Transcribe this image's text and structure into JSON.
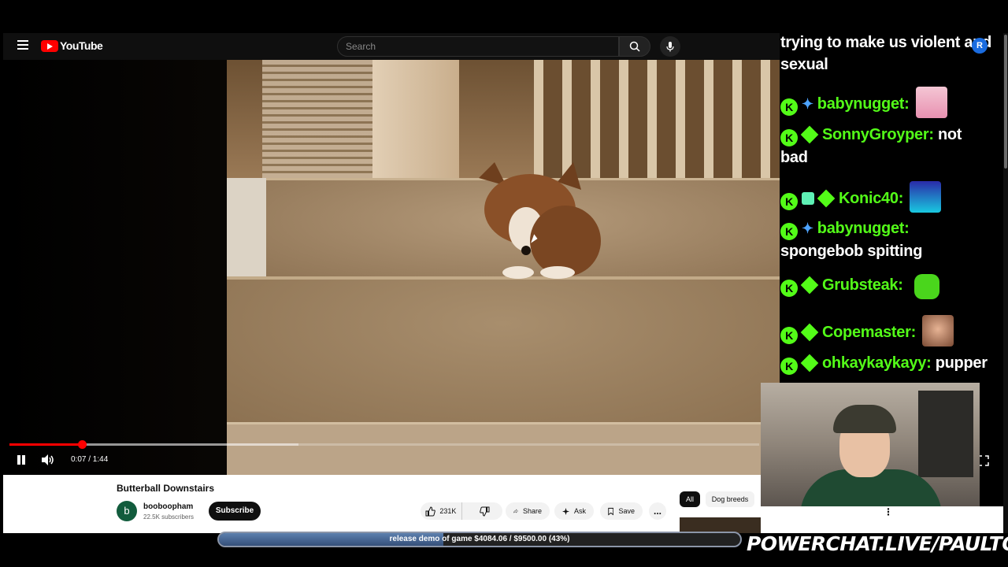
{
  "header": {
    "logo_text": "YouTube",
    "search_placeholder": "Search"
  },
  "player": {
    "current_time": "0:07",
    "duration": "1:44",
    "time_display": "0:07 / 1:44",
    "played_fraction": 0.097,
    "buffered_fraction": 0.385
  },
  "video": {
    "title": "Butterball Downstairs",
    "channel": {
      "avatar_letter": "b",
      "name": "booboopham",
      "subscribers": "22.5K subscribers",
      "subscribe_label": "Subscribe"
    },
    "actions": {
      "likes": "231K",
      "share_label": "Share",
      "ask_label": "Ask",
      "save_label": "Save",
      "more_label": "..."
    },
    "chips": {
      "all": "All",
      "dog_breeds": "Dog breeds"
    }
  },
  "chat": {
    "messages": [
      {
        "user": "",
        "text": "trying to make us violent and sexual"
      },
      {
        "user": "babynugget:",
        "text": ""
      },
      {
        "user": "SonnyGroyper:",
        "text": "not bad"
      },
      {
        "user": "Konic40:",
        "text": ""
      },
      {
        "user": "babynugget:",
        "text": "spongebob spitting"
      },
      {
        "user": "Grubsteak:",
        "text": ""
      },
      {
        "user": "Copemaster:",
        "text": ""
      },
      {
        "user": "ohkaykaykayy:",
        "text": "pupper"
      }
    ],
    "badge_letter": "K",
    "user_color": "#53fc18"
  },
  "account": {
    "avatar_letter": "R"
  },
  "goal": {
    "text": "release demo of game $4084.06 / $9500.00 (43%)",
    "fraction": 0.43
  },
  "overlay": {
    "brand": "POWERCHAT.LIVE/PAULTOWN"
  }
}
